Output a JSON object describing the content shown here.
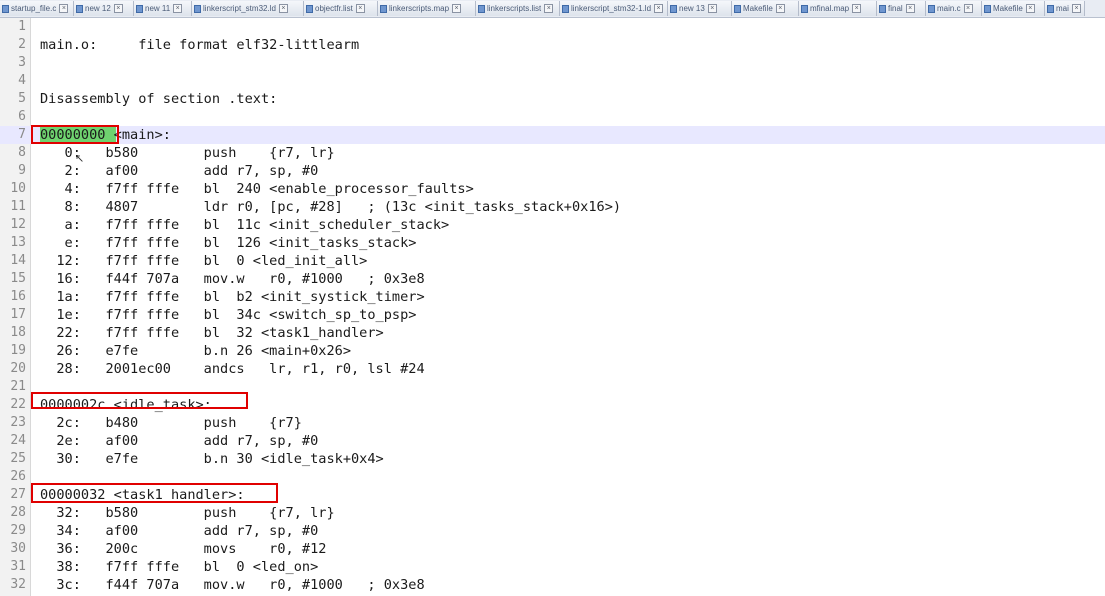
{
  "tabs": [
    {
      "label": "startup_file.c"
    },
    {
      "label": "new 12"
    },
    {
      "label": "new 11"
    },
    {
      "label": "linkerscript_stm32.ld"
    },
    {
      "label": "objectfr.list"
    },
    {
      "label": "linkerscripts.map"
    },
    {
      "label": "linkerscripts.list"
    },
    {
      "label": "linkerscript_stm32-1.ld"
    },
    {
      "label": "new 13"
    },
    {
      "label": "Makefile"
    },
    {
      "label": "mfinal.map"
    },
    {
      "label": "final"
    },
    {
      "label": "main.c"
    },
    {
      "label": "Makefile"
    },
    {
      "label": "main"
    }
  ],
  "close_glyph": "×",
  "lines": [
    {
      "num": "1",
      "text": ""
    },
    {
      "num": "2",
      "text": "main.o:     file format elf32-littlearm"
    },
    {
      "num": "3",
      "text": ""
    },
    {
      "num": "4",
      "text": ""
    },
    {
      "num": "5",
      "text": "Disassembly of section .text:"
    },
    {
      "num": "6",
      "text": ""
    },
    {
      "num": "7",
      "text": "00000000 <main>:"
    },
    {
      "num": "8",
      "text": "   0:   b580        push    {r7, lr}"
    },
    {
      "num": "9",
      "text": "   2:   af00        add r7, sp, #0"
    },
    {
      "num": "10",
      "text": "   4:   f7ff fffe   bl  240 <enable_processor_faults>"
    },
    {
      "num": "11",
      "text": "   8:   4807        ldr r0, [pc, #28]   ; (13c <init_tasks_stack+0x16>)"
    },
    {
      "num": "12",
      "text": "   a:   f7ff fffe   bl  11c <init_scheduler_stack>"
    },
    {
      "num": "13",
      "text": "   e:   f7ff fffe   bl  126 <init_tasks_stack>"
    },
    {
      "num": "14",
      "text": "  12:   f7ff fffe   bl  0 <led_init_all>"
    },
    {
      "num": "15",
      "text": "  16:   f44f 707a   mov.w   r0, #1000   ; 0x3e8"
    },
    {
      "num": "16",
      "text": "  1a:   f7ff fffe   bl  b2 <init_systick_timer>"
    },
    {
      "num": "17",
      "text": "  1e:   f7ff fffe   bl  34c <switch_sp_to_psp>"
    },
    {
      "num": "18",
      "text": "  22:   f7ff fffe   bl  32 <task1_handler>"
    },
    {
      "num": "19",
      "text": "  26:   e7fe        b.n 26 <main+0x26>"
    },
    {
      "num": "20",
      "text": "  28:   2001ec00    andcs   lr, r1, r0, lsl #24"
    },
    {
      "num": "21",
      "text": ""
    },
    {
      "num": "22",
      "text": "0000002c <idle_task>:"
    },
    {
      "num": "23",
      "text": "  2c:   b480        push    {r7}"
    },
    {
      "num": "24",
      "text": "  2e:   af00        add r7, sp, #0"
    },
    {
      "num": "25",
      "text": "  30:   e7fe        b.n 30 <idle_task+0x4>"
    },
    {
      "num": "26",
      "text": ""
    },
    {
      "num": "27",
      "text": "00000032 <task1_handler>:"
    },
    {
      "num": "28",
      "text": "  32:   b580        push    {r7, lr}"
    },
    {
      "num": "29",
      "text": "  34:   af00        add r7, sp, #0"
    },
    {
      "num": "30",
      "text": "  36:   200c        movs    r0, #12"
    },
    {
      "num": "31",
      "text": "  38:   f7ff fffe   bl  0 <led_on>"
    },
    {
      "num": "32",
      "text": "  3c:   f44f 707a   mov.w   r0, #1000   ; 0x3e8"
    }
  ],
  "colors": {
    "current_line": "#e8e8ff",
    "selection": "#6fd36f",
    "annotation_box": "#e00000"
  }
}
